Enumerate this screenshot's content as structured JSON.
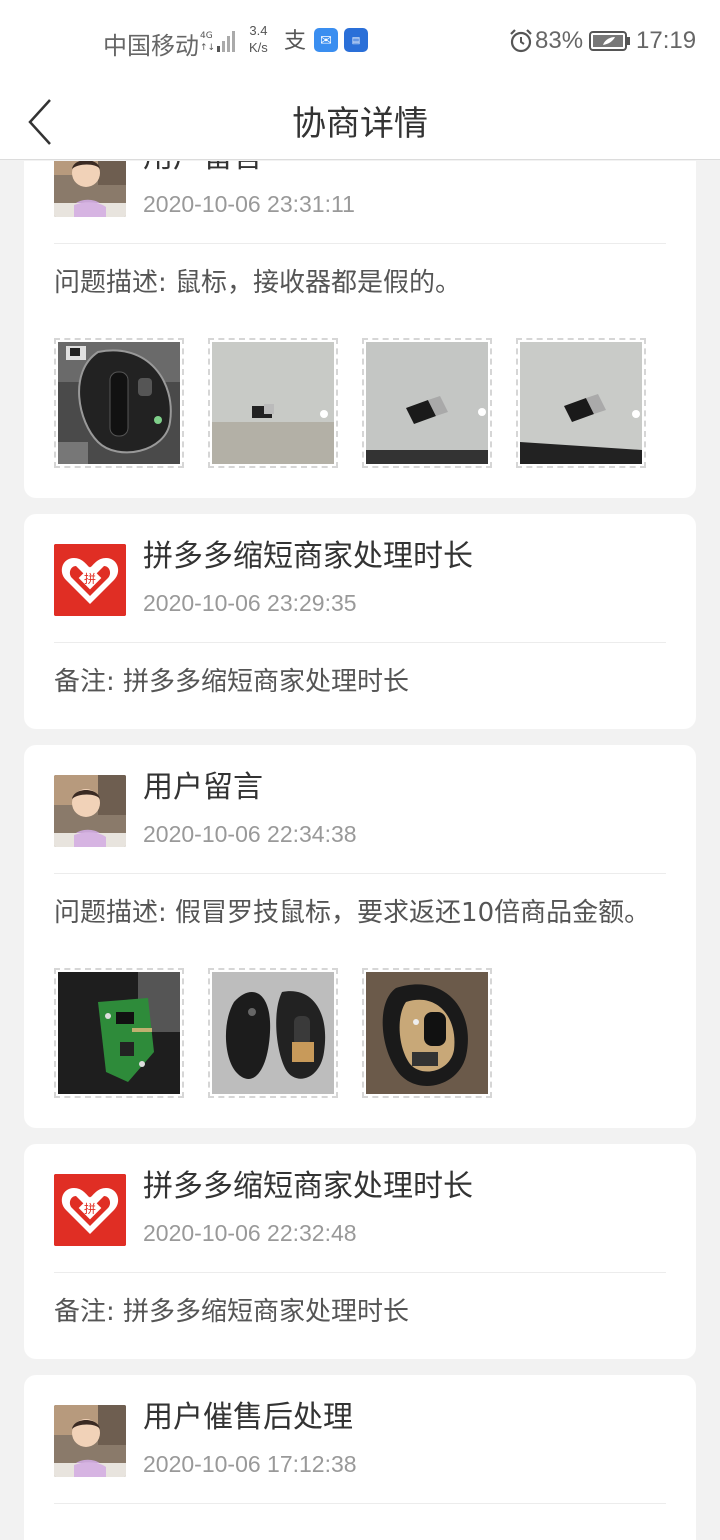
{
  "status_bar": {
    "carrier": "中国移动",
    "network": "4G",
    "speed_value": "3.4",
    "speed_unit": "K/s",
    "battery": "83%",
    "time": "17:19"
  },
  "header": {
    "title": "协商详情"
  },
  "colors": {
    "pdd_red": "#e02e24",
    "background": "#f2f2f2"
  },
  "records": [
    {
      "avatar": "user",
      "title": "用户留言",
      "time": "2020-10-06  23:31:11",
      "text": "问题描述: 鼠标，接收器都是假的。",
      "photos": [
        "mouse-with-receiver-photo",
        "receiver-on-table-photo",
        "receiver-closeup-photo",
        "receiver-closeup-photo-2"
      ]
    },
    {
      "avatar": "pinduoduo",
      "title": "拼多多缩短商家处理时长",
      "time": "2020-10-06  23:29:35",
      "text": "备注: 拼多多缩短商家处理时长",
      "photos": []
    },
    {
      "avatar": "user",
      "title": "用户留言",
      "time": "2020-10-06  22:34:38",
      "text": "问题描述: 假冒罗技鼠标，要求返还10倍商品金额。",
      "photos": [
        "circuit-board-photo",
        "opened-mouse-photo",
        "mouse-internals-photo"
      ]
    },
    {
      "avatar": "pinduoduo",
      "title": "拼多多缩短商家处理时长",
      "time": "2020-10-06  22:32:48",
      "text": "备注: 拼多多缩短商家处理时长",
      "photos": []
    },
    {
      "avatar": "user",
      "title": "用户催售后处理",
      "time": "2020-10-06  17:12:38",
      "text": "",
      "photos": []
    }
  ]
}
